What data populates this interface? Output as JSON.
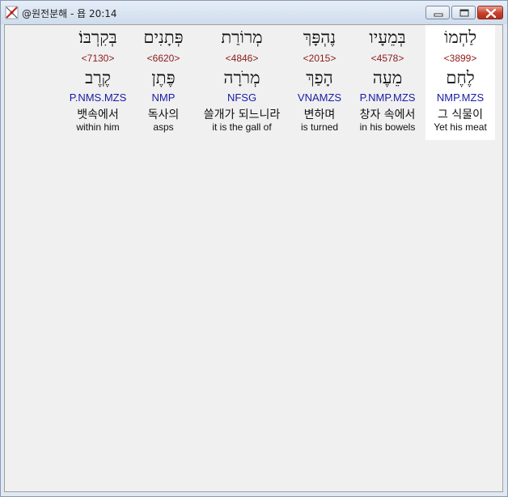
{
  "window": {
    "title": "@원전분해 - 욥 20:14",
    "controls": {
      "minimize": "minimize",
      "maximize": "maximize",
      "close": "close"
    }
  },
  "colors": {
    "strong_number": "#8b1a1a",
    "parsing": "#1a1aa8",
    "text": "#111111",
    "highlight": "#ffffff"
  },
  "words": [
    {
      "hebrew": "לַחְמוֹ",
      "strong": "<3899>",
      "lemma": "לֶחֶם",
      "parsing": "NMP.MZS",
      "korean": "그 식물이",
      "english": "Yet his meat",
      "selected": true
    },
    {
      "hebrew": "בְּמֵעָיו",
      "strong": "<4578>",
      "lemma": "מֵעֶה",
      "parsing": "P.NMP.MZS",
      "korean": "창자 속에서",
      "english": "in his bowels",
      "selected": false
    },
    {
      "hebrew": "נֶהְפָּךְ",
      "strong": "<2015>",
      "lemma": "הָפַךְ",
      "parsing": "VNAMZS",
      "korean": "변하며",
      "english": "is turned",
      "selected": false
    },
    {
      "hebrew": "מְרוֹרַת",
      "strong": "<4846>",
      "lemma": "מְרֹרָה",
      "parsing": "NFSG",
      "korean": "쓸개가 되느니라",
      "english": "it is the gall of",
      "selected": false
    },
    {
      "hebrew": "פְּתָנִים",
      "strong": "<6620>",
      "lemma": "פֶּתֶן",
      "parsing": "NMP",
      "korean": "독사의",
      "english": "asps",
      "selected": false
    },
    {
      "hebrew": "בְּקִרְבּוֹ׃",
      "strong": "<7130>",
      "lemma": "קֶרֶב",
      "parsing": "P.NMS.MZS",
      "korean": "뱃속에서",
      "english": "within him",
      "selected": false
    }
  ]
}
